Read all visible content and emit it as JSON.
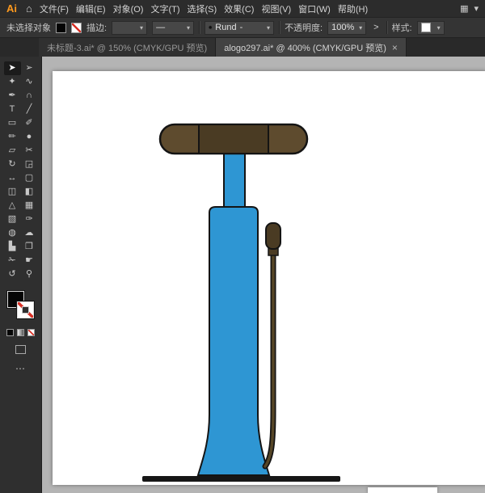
{
  "colors": {
    "ui-bg": "#2c2c2c",
    "ui-bar": "#343434",
    "ui-toolbar": "#2f2f2f",
    "ui-field": "#474747",
    "ui-text": "#d4d4d4",
    "ui-text-dim": "#979797",
    "accent-orange": "#ff9a1e",
    "tab-active-bg": "#424242",
    "tab-inactive-bg": "#303030",
    "pasteboard": "#b4b4b4",
    "artboard": "#ffffff",
    "none-red": "#d93025",
    "pump-blue": "#2e96d3",
    "pump-outline": "#141414",
    "handle-brown": "#5e4b2e",
    "handle-dark": "#4a3b23",
    "hose-olive": "#564627",
    "base-black": "#161616"
  },
  "icons": {
    "home": "⌂",
    "workspace": "▦",
    "chevron_down": "▾",
    "ellipsis": "⋯",
    "close": "×"
  },
  "menubar": {
    "logo": "Ai",
    "items": [
      {
        "name": "file",
        "label": "文件(F)"
      },
      {
        "name": "edit",
        "label": "编辑(E)"
      },
      {
        "name": "object",
        "label": "对象(O)"
      },
      {
        "name": "type",
        "label": "文字(T)"
      },
      {
        "name": "select",
        "label": "选择(S)"
      },
      {
        "name": "effect",
        "label": "效果(C)"
      },
      {
        "name": "view",
        "label": "视图(V)"
      },
      {
        "name": "window",
        "label": "窗口(W)"
      },
      {
        "name": "help",
        "label": "帮助(H)"
      }
    ]
  },
  "controlbar": {
    "no_selection_label": "未选择对象",
    "stroke_label": "描边:",
    "profile_value": "—",
    "brush_bullet": "•",
    "brush_value": "Rund",
    "brush_dash": "-",
    "opacity_label": "不透明度:",
    "opacity_value": "100%",
    "expand_chevron": ">",
    "style_label": "样式:"
  },
  "tabs": [
    {
      "label": "未标题-3.ai* @ 150% (CMYK/GPU 预览)",
      "active": false
    },
    {
      "label": "alogo297.ai* @ 400% (CMYK/GPU 预览)",
      "active": true
    }
  ],
  "toolbar": {
    "tools": [
      {
        "name": "selection",
        "glyph": "➤",
        "active": true
      },
      {
        "name": "direct-selection",
        "glyph": "➢"
      },
      {
        "name": "magic-wand",
        "glyph": "✦"
      },
      {
        "name": "lasso",
        "glyph": "∿"
      },
      {
        "name": "pen",
        "glyph": "✒"
      },
      {
        "name": "curvature",
        "glyph": "∩"
      },
      {
        "name": "type",
        "glyph": "T"
      },
      {
        "name": "line-segment",
        "glyph": "╱"
      },
      {
        "name": "rectangle",
        "glyph": "▭"
      },
      {
        "name": "paintbrush",
        "glyph": "✐"
      },
      {
        "name": "pencil",
        "glyph": "✏"
      },
      {
        "name": "blob-brush",
        "glyph": "●"
      },
      {
        "name": "eraser",
        "glyph": "▱"
      },
      {
        "name": "scissors",
        "glyph": "✂"
      },
      {
        "name": "rotate",
        "glyph": "↻"
      },
      {
        "name": "scale",
        "glyph": "◲"
      },
      {
        "name": "width",
        "glyph": "↔"
      },
      {
        "name": "free-transform",
        "glyph": "▢"
      },
      {
        "name": "shape-builder",
        "glyph": "◫"
      },
      {
        "name": "live-paint",
        "glyph": "◧"
      },
      {
        "name": "perspective-grid",
        "glyph": "△"
      },
      {
        "name": "mesh",
        "glyph": "▦"
      },
      {
        "name": "gradient",
        "glyph": "▧"
      },
      {
        "name": "eyedropper",
        "glyph": "✑"
      },
      {
        "name": "blend",
        "glyph": "◍"
      },
      {
        "name": "symbol-sprayer",
        "glyph": "☁"
      },
      {
        "name": "column-graph",
        "glyph": "▙"
      },
      {
        "name": "artboard",
        "glyph": "❐"
      },
      {
        "name": "slice",
        "glyph": "✁"
      },
      {
        "name": "hand",
        "glyph": "☛"
      },
      {
        "name": "rotate-view",
        "glyph": "↺"
      },
      {
        "name": "zoom",
        "glyph": "⚲"
      }
    ]
  }
}
